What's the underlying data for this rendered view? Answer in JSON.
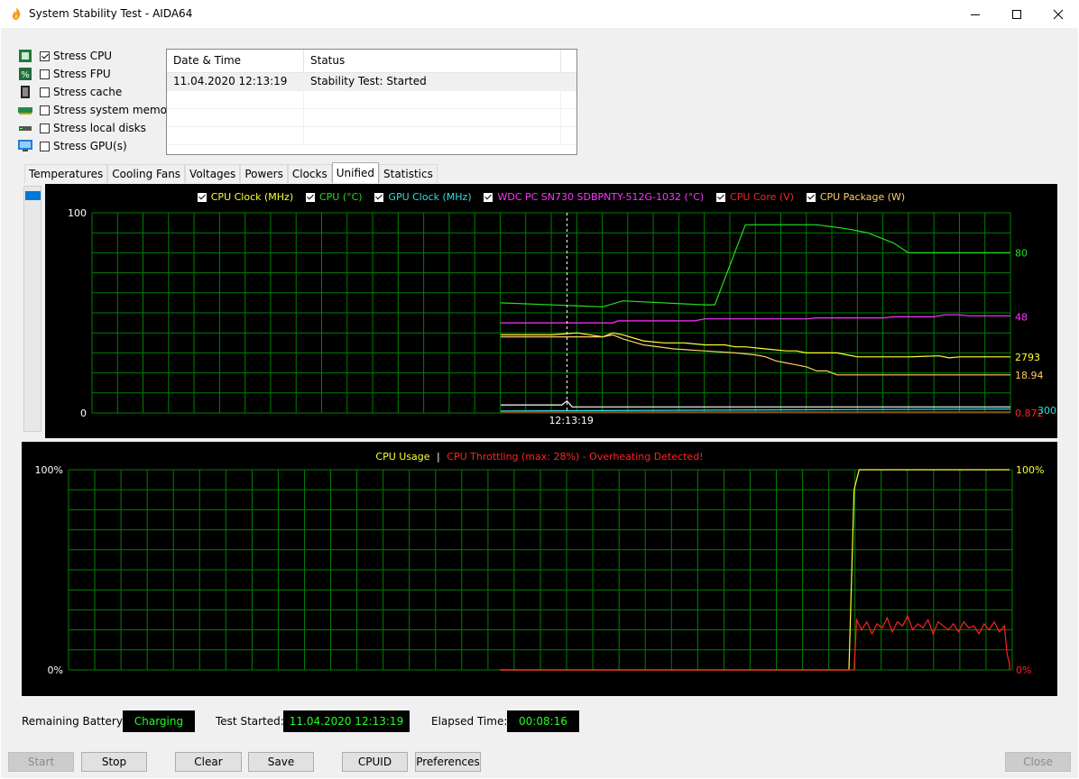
{
  "window": {
    "title": "System Stability Test - AIDA64"
  },
  "stress": [
    {
      "label": "Stress CPU",
      "checked": true
    },
    {
      "label": "Stress FPU",
      "checked": false
    },
    {
      "label": "Stress cache",
      "checked": false
    },
    {
      "label": "Stress system memory",
      "checked": false
    },
    {
      "label": "Stress local disks",
      "checked": false
    },
    {
      "label": "Stress GPU(s)",
      "checked": false
    }
  ],
  "log": {
    "col_datetime": "Date & Time",
    "col_status": "Status",
    "rows": [
      {
        "datetime": "11.04.2020 12:13:19",
        "status": "Stability Test: Started"
      }
    ]
  },
  "tabs": [
    "Temperatures",
    "Cooling Fans",
    "Voltages",
    "Powers",
    "Clocks",
    "Unified",
    "Statistics"
  ],
  "active_tab": "Unified",
  "colors": {
    "grid": "#008000",
    "green": "#22dd22",
    "yellow": "#ffff33",
    "cyan": "#33dddd",
    "magenta": "#ff33ff",
    "red": "#ff2222",
    "orange": "#ffcc66"
  },
  "chart_data": [
    {
      "type": "line",
      "legend": [
        {
          "name": "CPU Clock (MHz)",
          "color": "#ffff33"
        },
        {
          "name": "CPU (°C)",
          "color": "#22dd22"
        },
        {
          "name": "GPU Clock (MHz)",
          "color": "#33dddd"
        },
        {
          "name": "WDC PC SN730 SDBPNTY-512G-1032 (°C)",
          "color": "#ff33ff"
        },
        {
          "name": "CPU Core (V)",
          "color": "#ff2222"
        },
        {
          "name": "CPU Package (W)",
          "color": "#ffcc66"
        }
      ],
      "ylim": [
        0,
        100
      ],
      "y_top_label": "100",
      "y_bottom_label": "0",
      "x_label": "12:13:19",
      "right_values": [
        {
          "text": "80",
          "color": "#22dd22",
          "level": 80
        },
        {
          "text": "48",
          "color": "#ff33ff",
          "level": 48
        },
        {
          "text": "2793",
          "color": "#ffff33",
          "level": 28
        },
        {
          "text": "18.94",
          "color": "#ffcc66",
          "level": 19
        },
        {
          "text": "0.872",
          "color": "#ff2222",
          "level": 0
        }
      ],
      "cyan_label": "300",
      "series": [
        {
          "name": "CPU (°C)",
          "color": "#22dd22",
          "x": [
            0,
            20,
            24,
            40,
            42,
            48,
            60,
            62,
            65,
            68,
            70,
            72,
            75,
            77,
            80,
            90,
            100
          ],
          "values": [
            55,
            53,
            56,
            54,
            54,
            94,
            94,
            94,
            93,
            92,
            91,
            90,
            87,
            85,
            80,
            80,
            80
          ]
        },
        {
          "name": "WDC PC SN730 SDBPNTY-512G-1032 (°C)",
          "color": "#ff33ff",
          "x": [
            0,
            22,
            23,
            38,
            40,
            60,
            62,
            75,
            77,
            85,
            87,
            90,
            92,
            100
          ],
          "values": [
            45,
            45,
            46,
            46,
            47,
            47,
            47.5,
            47.5,
            48,
            48,
            49,
            49,
            48.5,
            48.5
          ]
        },
        {
          "name": "CPU Clock (MHz)",
          "color": "#ffff33",
          "x": [
            0,
            10,
            15,
            20,
            22,
            24,
            28,
            32,
            36,
            40,
            44,
            46,
            48,
            52,
            56,
            58,
            60,
            66,
            68,
            70,
            78,
            80,
            86,
            88,
            90,
            100
          ],
          "values": [
            39,
            39,
            40,
            38,
            40,
            39,
            36,
            35,
            35,
            34,
            34,
            33,
            33,
            32,
            31,
            31,
            30,
            30,
            29,
            28,
            28,
            28,
            28.5,
            27.5,
            28,
            28
          ]
        },
        {
          "name": "CPU Package (W)",
          "color": "#ffcc66",
          "x": [
            0,
            20,
            22,
            24,
            28,
            34,
            40,
            46,
            50,
            52,
            54,
            56,
            58,
            60,
            62,
            64,
            66,
            100
          ],
          "values": [
            38,
            38,
            39,
            37,
            34,
            32,
            31,
            30,
            29,
            28,
            26,
            25,
            24,
            23,
            21,
            21,
            19,
            19
          ]
        },
        {
          "name": "CPU Clock (MHz)",
          "color": "#ffffff",
          "x": [
            0,
            12,
            13,
            14,
            100
          ],
          "values": [
            4,
            4,
            6,
            3,
            3
          ]
        },
        {
          "name": "GPU Clock (MHz)",
          "color": "#33dddd",
          "x": [
            0,
            100
          ],
          "values": [
            1,
            2
          ]
        },
        {
          "name": "CPU Core (V)",
          "color": "#ff2222",
          "x": [
            0,
            100
          ],
          "values": [
            0.5,
            0.5
          ]
        }
      ]
    },
    {
      "type": "line",
      "title_usage": "CPU Usage",
      "separator": "|",
      "title_throttle": "CPU Throttling (max: 28%) - Overheating Detected!",
      "ylim": [
        0,
        100
      ],
      "y_top_label": "100%",
      "y_bottom_label": "0%",
      "right_top_label": "100%",
      "right_bottom_label": "0%",
      "series": [
        {
          "name": "CPU Usage",
          "color": "#ffff33",
          "x": [
            0,
            68.5,
            69.5,
            70.5,
            100
          ],
          "values": [
            0,
            0,
            90,
            100,
            100
          ]
        },
        {
          "name": "CPU Throttling",
          "color": "#ff2222",
          "x": [
            0,
            69.5,
            70,
            71,
            72,
            73,
            74,
            75,
            76,
            77,
            78,
            79,
            80,
            81,
            82,
            83,
            84,
            85,
            86,
            87,
            88,
            89,
            90,
            91,
            92,
            93,
            94,
            95,
            96,
            97,
            98,
            99,
            99.5,
            100,
            101,
            102
          ],
          "values": [
            0,
            0,
            25,
            20,
            24,
            18,
            23,
            21,
            26,
            19,
            24,
            22,
            27,
            20,
            23,
            21,
            25,
            18,
            24,
            22,
            20,
            23,
            19,
            24,
            21,
            22,
            18,
            23,
            20,
            24,
            19,
            22,
            8,
            3,
            0,
            0
          ]
        }
      ]
    }
  ],
  "status": {
    "battery_label": "Remaining Battery:",
    "battery_value": "Charging",
    "started_label": "Test Started:",
    "started_value": "11.04.2020 12:13:19",
    "elapsed_label": "Elapsed Time:",
    "elapsed_value": "00:08:16"
  },
  "buttons": {
    "start": "Start",
    "stop": "Stop",
    "clear": "Clear",
    "save": "Save",
    "cpuid": "CPUID",
    "preferences": "Preferences",
    "close": "Close"
  }
}
